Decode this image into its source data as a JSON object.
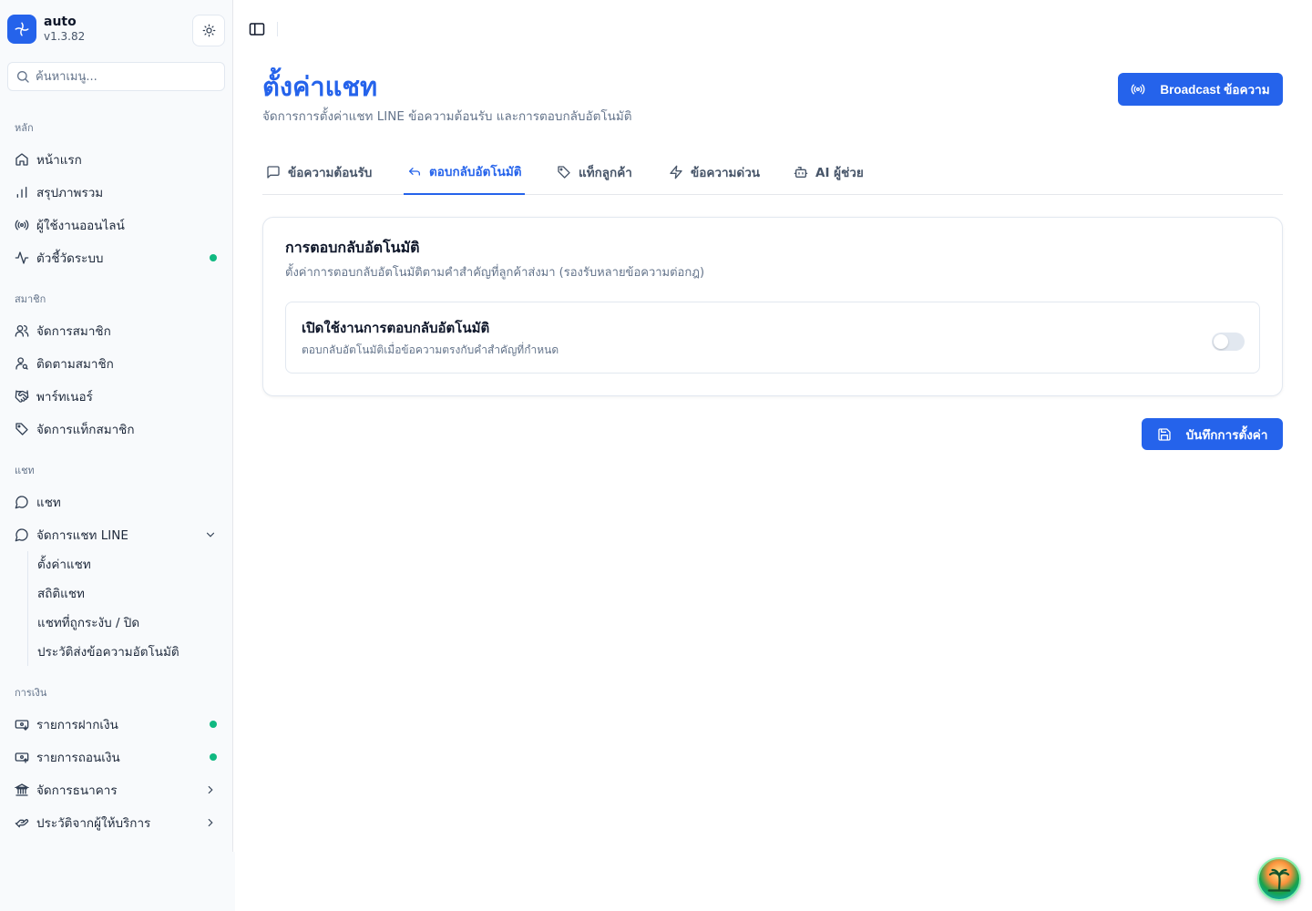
{
  "app": {
    "name": "auto",
    "version": "v1.3.82"
  },
  "search": {
    "placeholder": "ค้นหาเมนู..."
  },
  "sidebar": {
    "groups": [
      {
        "label": "หลัก"
      },
      {
        "label": "สมาชิก"
      },
      {
        "label": "แชท"
      },
      {
        "label": "การเงิน"
      }
    ],
    "items": [
      {
        "label": "หน้าแรก",
        "icon": "home-icon"
      },
      {
        "label": "สรุปภาพรวม",
        "icon": "bar-chart-icon"
      },
      {
        "label": "ผู้ใช้งานออนไลน์",
        "icon": "radio-icon"
      },
      {
        "label": "ตัวชี้วัดระบบ",
        "icon": "activity-icon",
        "status_dot": "#10b981"
      },
      {
        "label": "จัดการสมาชิก",
        "icon": "users-icon"
      },
      {
        "label": "ติดตามสมาชิก",
        "icon": "user-search-icon"
      },
      {
        "label": "พาร์ทเนอร์",
        "icon": "handshake-icon"
      },
      {
        "label": "จัดการแท็กสมาชิก",
        "icon": "tag-icon"
      },
      {
        "label": "แชท",
        "icon": "chat-icon"
      },
      {
        "label": "จัดการแชท LINE",
        "icon": "chat-icon"
      },
      {
        "label": "รายการฝากเงิน",
        "icon": "wallet-in-icon",
        "status_dot": "#10b981"
      },
      {
        "label": "รายการถอนเงิน",
        "icon": "wallet-out-icon",
        "status_dot": "#10b981"
      },
      {
        "label": "จัดการธนาคาร",
        "icon": "bank-icon"
      },
      {
        "label": "ประวัติจากผู้ให้บริการ",
        "icon": "provider-icon"
      }
    ],
    "line_sub": [
      "ตั้งค่าแชท",
      "สถิติแชท",
      "แชทที่ถูกระงับ / ปิด",
      "ประวัติส่งข้อความอัตโนมัติ"
    ]
  },
  "page": {
    "title": "ตั้งค่าแชท",
    "subtitle": "จัดการการตั้งค่าแชท LINE ข้อความต้อนรับ และการตอบกลับอัตโนมัติ",
    "broadcast_label": "Broadcast ข้อความ",
    "save_label": "บันทึกการตั้งค่า"
  },
  "tabs": [
    {
      "label": "ข้อความต้อนรับ",
      "icon": "message-square-icon"
    },
    {
      "label": "ตอบกลับอัตโนมัติ",
      "icon": "reply-icon",
      "active": true
    },
    {
      "label": "แท็กลูกค้า",
      "icon": "tag-icon"
    },
    {
      "label": "ข้อความด่วน",
      "icon": "zap-icon"
    },
    {
      "label": "AI ผู้ช่วย",
      "icon": "bot-icon"
    }
  ],
  "card": {
    "title": "การตอบกลับอัตโนมัติ",
    "description": "ตั้งค่าการตอบกลับอัตโนมัติตามคำสำคัญที่ลูกค้าส่งมา (รองรับหลายข้อความต่อกฎ)",
    "setting": {
      "title": "เปิดใช้งานการตอบกลับอัตโนมัติ",
      "description": "ตอบกลับอัตโนมัติเมื่อข้อความตรงกับคำสำคัญที่กำหนด",
      "enabled": false
    }
  },
  "colors": {
    "accent": "#2563eb",
    "status_online": "#10b981"
  }
}
